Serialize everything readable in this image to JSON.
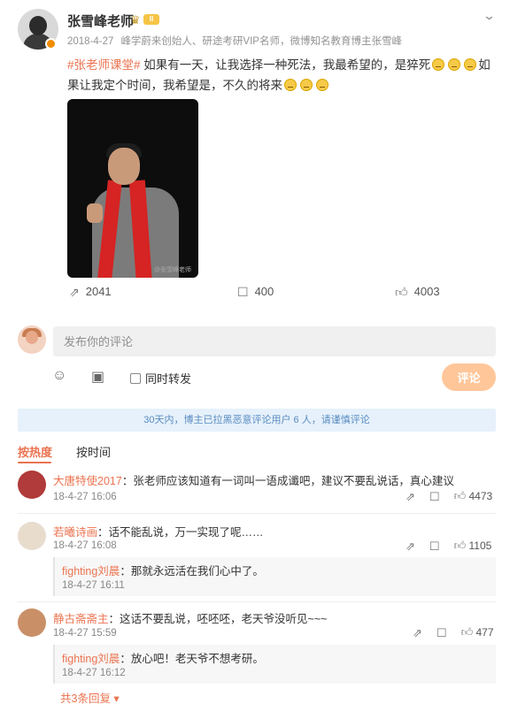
{
  "post": {
    "author": "张雪峰老师",
    "vip_badge": "II",
    "date": "2018-4-27",
    "source": "峰学蔚来创始人、研途考研VIP名师，微博知名教育博主张雪峰",
    "hashtag": "#张老师课堂#",
    "text_line1": "如果有一天，让我选择一种死法，我最希望的，是猝死",
    "text_line2_pre": "如",
    "text_line2": "果让我定个时间，我希望是，不久的将来",
    "image_watermark": "@张雪峰老师",
    "reposts": "2041",
    "comments": "400",
    "likes": "4003"
  },
  "composer": {
    "placeholder": "发布你的评论",
    "repost_label": "同时转发",
    "submit_label": "评论"
  },
  "notice": "30天内，博主已拉黑恶意评论用户 6 人，请谨慎评论",
  "tabs": {
    "hot": "按热度",
    "time": "按时间"
  },
  "comments": [
    {
      "user": "大唐特使2017",
      "text": "：张老师应该知道有一词叫一语成谶吧，建议不要乱说话，真心建议",
      "time": "18-4-27 16:06",
      "likes": "4473"
    },
    {
      "user": "若曦诗画",
      "text": "：话不能乱说，万一实现了呢……",
      "time": "18-4-27 16:08",
      "likes": "1105",
      "reply": {
        "user": "fighting刘晨",
        "text": "：那就永远活在我们心中了。",
        "time": "18-4-27 16:11"
      }
    },
    {
      "user": "静古斋斋主",
      "text": "：这话不要乱说，呸呸呸，老天爷没听见~~~",
      "time": "18-4-27 15:59",
      "likes": "477",
      "reply": {
        "user": "fighting刘晨",
        "text": "：放心吧！老天爷不想考研。",
        "time": "18-4-27 16:12"
      },
      "more": "共3条回复"
    }
  ],
  "colors": {
    "accent": "#eb7350",
    "notice_bg": "#e6f1fb",
    "submit_bg": "#ffc699"
  },
  "icons": [
    "chevron-down-icon",
    "repost-icon",
    "comment-icon",
    "like-icon",
    "emoji-icon",
    "image-icon"
  ]
}
